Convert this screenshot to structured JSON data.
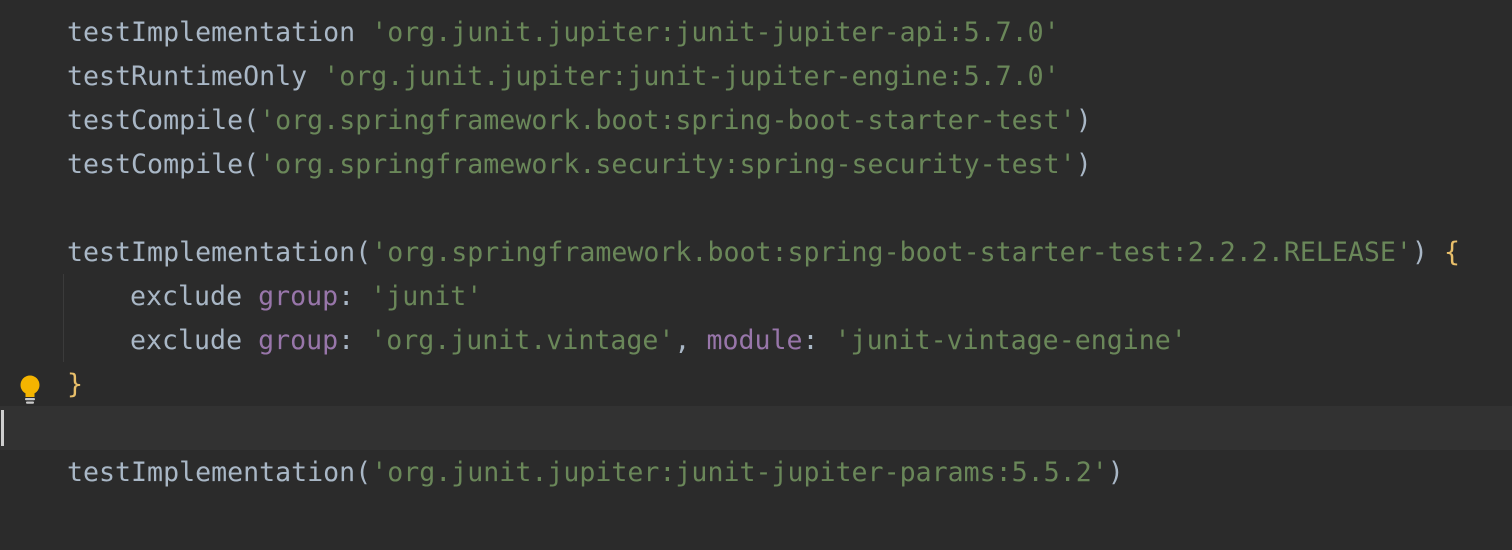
{
  "editor": {
    "lines": [
      {
        "fn": "testImplementation",
        "sep": " ",
        "str": "'org.junit.jupiter:junit-jupiter-api:5.7.0'",
        "end": ""
      },
      {
        "fn": "testRuntimeOnly",
        "sep": " ",
        "str": "'org.junit.jupiter:junit-jupiter-engine:5.7.0'",
        "end": ""
      },
      {
        "fn": "testCompile",
        "sep": "(",
        "str": "'org.springframework.boot:spring-boot-starter-test'",
        "end": ")"
      },
      {
        "fn": "testCompile",
        "sep": "(",
        "str": "'org.springframework.security:spring-security-test'",
        "end": ")"
      },
      {
        "fn": "testImplementation",
        "sep": "(",
        "str": "'org.springframework.boot:spring-boot-starter-test:2.2.2.RELEASE'",
        "end": ") ",
        "brace": "{"
      },
      {
        "kw": "exclude",
        "prop1": "group",
        "colon1": ": ",
        "str1": "'junit'"
      },
      {
        "kw": "exclude",
        "prop1": "group",
        "colon1": ": ",
        "str1": "'org.junit.vintage'",
        "comma": ", ",
        "prop2": "module",
        "colon2": ": ",
        "str2": "'junit-vintage-engine'"
      },
      {
        "brace": "}"
      },
      {
        "fn": "testImplementation",
        "sep": "(",
        "str": "'org.junit.jupiter:junit-jupiter-params:5.5.2'",
        "end": ")"
      }
    ]
  },
  "icons": {
    "intention": "lightbulb-icon",
    "intention_color": "#f4b400"
  },
  "colors": {
    "background": "#2b2b2b",
    "current_line": "#323232",
    "string": "#6a8759",
    "identifier": "#a9b7c6",
    "named_arg": "#9876aa"
  }
}
